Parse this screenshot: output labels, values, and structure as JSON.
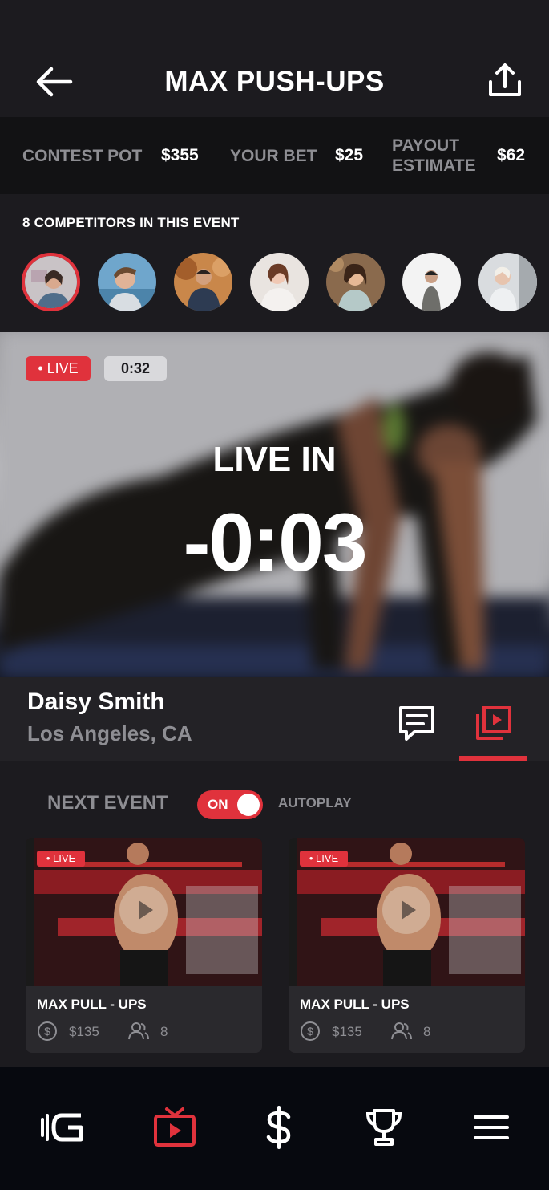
{
  "header": {
    "title": "MAX PUSH-UPS"
  },
  "stats": {
    "contest_pot_label": "CONTEST POT",
    "contest_pot_value": "$355",
    "your_bet_label": "YOUR BET",
    "your_bet_value": "$25",
    "payout_label_line1": "PAYOUT",
    "payout_label_line2": "ESTIMATE",
    "payout_value": "$62"
  },
  "competitors": {
    "title": "8 COMPETITORS IN THIS EVENT",
    "visible_avatars": 7
  },
  "video": {
    "live_badge": "• LIVE",
    "elapsed": "0:32",
    "live_in_label": "LIVE IN",
    "countdown": "-0:03"
  },
  "athlete": {
    "name": "Daisy Smith",
    "location": "Los Angeles, CA"
  },
  "next_event": {
    "label": "NEXT EVENT",
    "toggle_state": "ON",
    "autoplay_label": "AUTOPLAY"
  },
  "cards": [
    {
      "live": "• LIVE",
      "title": "MAX PULL - UPS",
      "price": "$135",
      "participants": "8"
    },
    {
      "live": "• LIVE",
      "title": "MAX PULL - UPS",
      "price": "$135",
      "participants": "8"
    }
  ],
  "nav": {
    "items": [
      "logo-icon",
      "tv-icon",
      "dollar-icon",
      "trophy-icon",
      "menu-icon"
    ],
    "active": "tv-icon"
  },
  "colors": {
    "accent": "#e0323c",
    "background": "#1c1b1f",
    "muted": "#8e8e93"
  }
}
